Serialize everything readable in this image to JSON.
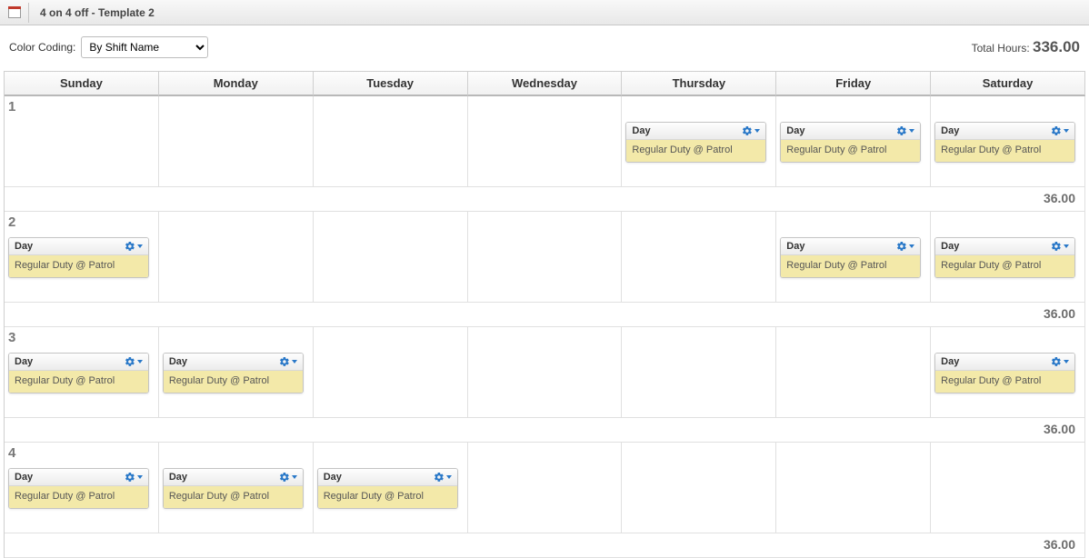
{
  "toolbar": {
    "title": "4 on 4 off - Template 2"
  },
  "filters": {
    "color_coding_label": "Color Coding:",
    "color_coding_value": "By Shift Name"
  },
  "totals": {
    "label": "Total Hours:",
    "value": "336.00"
  },
  "days": [
    "Sunday",
    "Monday",
    "Tuesday",
    "Wednesday",
    "Thursday",
    "Friday",
    "Saturday"
  ],
  "shift": {
    "name": "Day",
    "desc": "Regular Duty @ Patrol"
  },
  "weeks": [
    {
      "num": "1",
      "cells": [
        false,
        false,
        false,
        false,
        true,
        true,
        true
      ],
      "total": "36.00"
    },
    {
      "num": "2",
      "cells": [
        true,
        false,
        false,
        false,
        false,
        true,
        true
      ],
      "total": "36.00"
    },
    {
      "num": "3",
      "cells": [
        true,
        true,
        false,
        false,
        false,
        false,
        true
      ],
      "total": "36.00"
    },
    {
      "num": "4",
      "cells": [
        true,
        true,
        true,
        false,
        false,
        false,
        false
      ],
      "total": "36.00"
    }
  ]
}
